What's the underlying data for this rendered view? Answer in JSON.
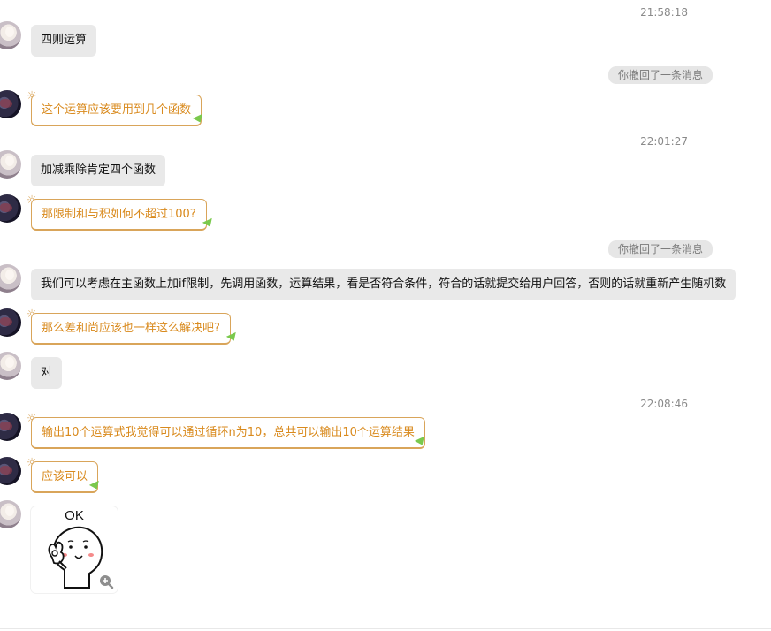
{
  "chat": {
    "times": [
      "21:58:18",
      "22:01:27",
      "22:08:46"
    ],
    "recall_notice": "你撤回了一条消息",
    "messages": [
      {
        "text": "四则运算"
      },
      {
        "text": "这个运算应该要用到几个函数"
      },
      {
        "text": "加减乘除肯定四个函数"
      },
      {
        "text": "那限制和与积如何不超过100?"
      },
      {
        "text": "我们可以考虑在主函数上加if限制，先调用函数，运算结果，看是否符合条件，符合的话就提交给用户回答，否则的话就重新产生随机数"
      },
      {
        "text": "那么差和尚应该也一样这么解决吧?"
      },
      {
        "text": "对"
      },
      {
        "text": "输出10个运算式我觉得可以通过循环n为10，总共可以输出10个运算结果"
      },
      {
        "text": "应该可以"
      }
    ],
    "sticker": {
      "caption": "OK",
      "icon": "zoom-in-icon"
    },
    "colors": {
      "self_bubble_text": "#d98a1d",
      "self_bubble_border": "#d9a55a",
      "other_bubble_bg": "#e9e9e9",
      "timestamp": "#8a8a8a"
    }
  }
}
